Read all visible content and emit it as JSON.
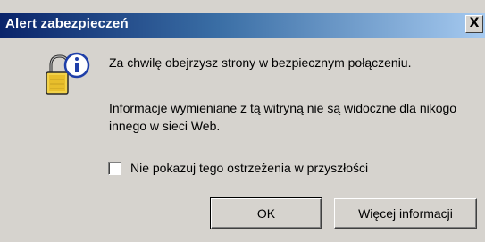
{
  "window": {
    "title": "Alert zabezpieczeń",
    "close_symbol": "X"
  },
  "icon": "lock-info-icon",
  "message": {
    "line1": "Za chwilę obejrzysz strony w bezpiecznym połączeniu.",
    "line2": "Informacje wymieniane z tą witryną nie są widoczne dla nikogo innego w sieci Web."
  },
  "checkbox": {
    "label": "Nie pokazuj tego ostrzeżenia w przyszłości",
    "checked": false
  },
  "buttons": {
    "ok": "OK",
    "more_info": "Więcej informacji"
  }
}
